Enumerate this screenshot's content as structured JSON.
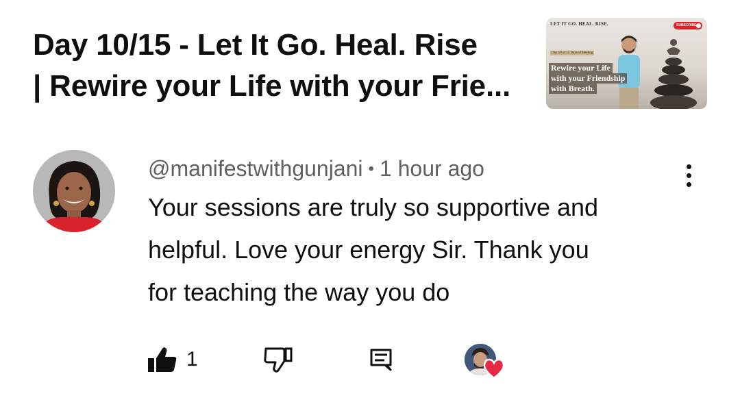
{
  "video": {
    "title_line1": "Day 10/15 - Let It Go. Heal. Rise",
    "title_line2": "|  Rewire your Life with your Frie...",
    "thumbnail": {
      "top_text": "LET IT GO. HEAL. RISE.",
      "sub_text": "Day 10 of 15 Days of Healing",
      "headline_line1": "Rewire your Life",
      "headline_line2": "with your Friendship",
      "headline_line3": "with Breath.",
      "subscribe_label": "SUBSCRIBE"
    }
  },
  "comment": {
    "author": "@manifestwithgunjani",
    "separator": "•",
    "time": "1 hour ago",
    "text_line1": "Your sessions are truly so supportive and",
    "text_line2": "helpful. Love your energy Sir. Thank you",
    "text_line3": "for teaching the way you do",
    "like_count": "1",
    "icons": {
      "like": "thumbs-up-filled-icon",
      "dislike": "thumbs-down-outline-icon",
      "reply": "comment-icon",
      "more": "more-vertical-icon",
      "creator_heart": "heart-icon"
    }
  },
  "colors": {
    "text_primary": "#0f0f0f",
    "text_secondary": "#606060",
    "heart_red": "#e62a46"
  }
}
